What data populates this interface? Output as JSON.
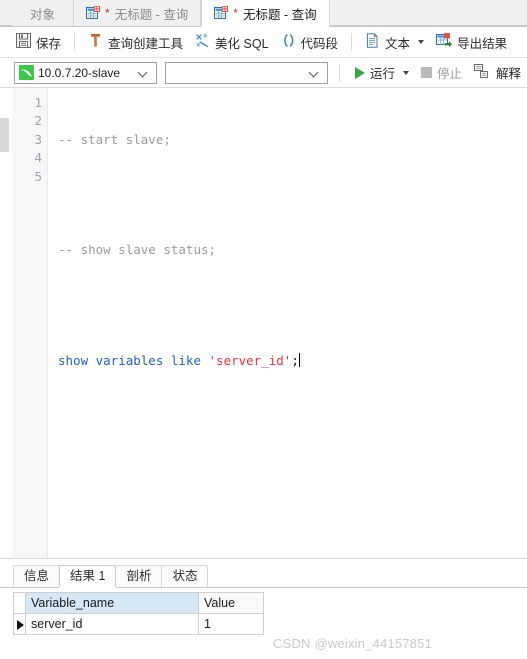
{
  "window": {
    "tabs": [
      {
        "name": "object-tab",
        "label": "对象",
        "icon": null,
        "modified": false,
        "active": false
      },
      {
        "name": "query-tab-1",
        "label": "无标题 - 查询",
        "icon": "table-grid-icon",
        "modified": true,
        "active": false
      },
      {
        "name": "query-tab-2",
        "label": "无标题 - 查询",
        "icon": "table-grid-icon",
        "modified": true,
        "active": true
      }
    ],
    "modified_marker": "*"
  },
  "toolbar": {
    "save_label": "保存",
    "query_builder_label": "查询创建工具",
    "beautify_label": "美化 SQL",
    "snippet_label": "代码段",
    "text_label": "文本",
    "export_label": "导出结果"
  },
  "connbar": {
    "connection_value": "10.0.7.20-slave",
    "database_value": "",
    "run_label": "运行",
    "stop_label": "停止",
    "explain_label": "解释"
  },
  "editor": {
    "line_numbers": [
      "1",
      "2",
      "3",
      "4",
      "5"
    ],
    "lines": [
      {
        "no": "1",
        "tokens": [
          {
            "t": "-- start slave;",
            "c": "cmt"
          }
        ]
      },
      {
        "no": "2",
        "tokens": []
      },
      {
        "no": "3",
        "tokens": [
          {
            "t": "-- show slave status;",
            "c": "cmt"
          }
        ]
      },
      {
        "no": "4",
        "tokens": []
      },
      {
        "no": "5",
        "tokens": [
          {
            "t": "show variables like ",
            "c": "kw"
          },
          {
            "t": "'server_id'",
            "c": "str"
          },
          {
            "t": ";",
            "c": "pun"
          }
        ]
      }
    ],
    "plain_text": "-- start slave;\n\n-- show slave status;\n\nshow variables like 'server_id';"
  },
  "results": {
    "tabs": [
      {
        "name": "info-tab",
        "label": "信息",
        "active": false
      },
      {
        "name": "result-1-tab",
        "label": "结果 1",
        "active": true
      },
      {
        "name": "profile-tab",
        "label": "剖析",
        "active": false
      },
      {
        "name": "status-tab",
        "label": "状态",
        "active": false
      }
    ],
    "columns": [
      "Variable_name",
      "Value"
    ],
    "rows": [
      {
        "Variable_name": "server_id",
        "Value": "1"
      }
    ],
    "selected_column": "Variable_name"
  },
  "watermark": {
    "text": "CSDN @weixin_44157851"
  },
  "colors": {
    "accent_green": "#37a63c",
    "keyword_blue": "#1f5fd0",
    "string_red": "#e8333a",
    "comment_gray": "#9a9a9a",
    "header_select_blue": "#d6e7f6"
  }
}
